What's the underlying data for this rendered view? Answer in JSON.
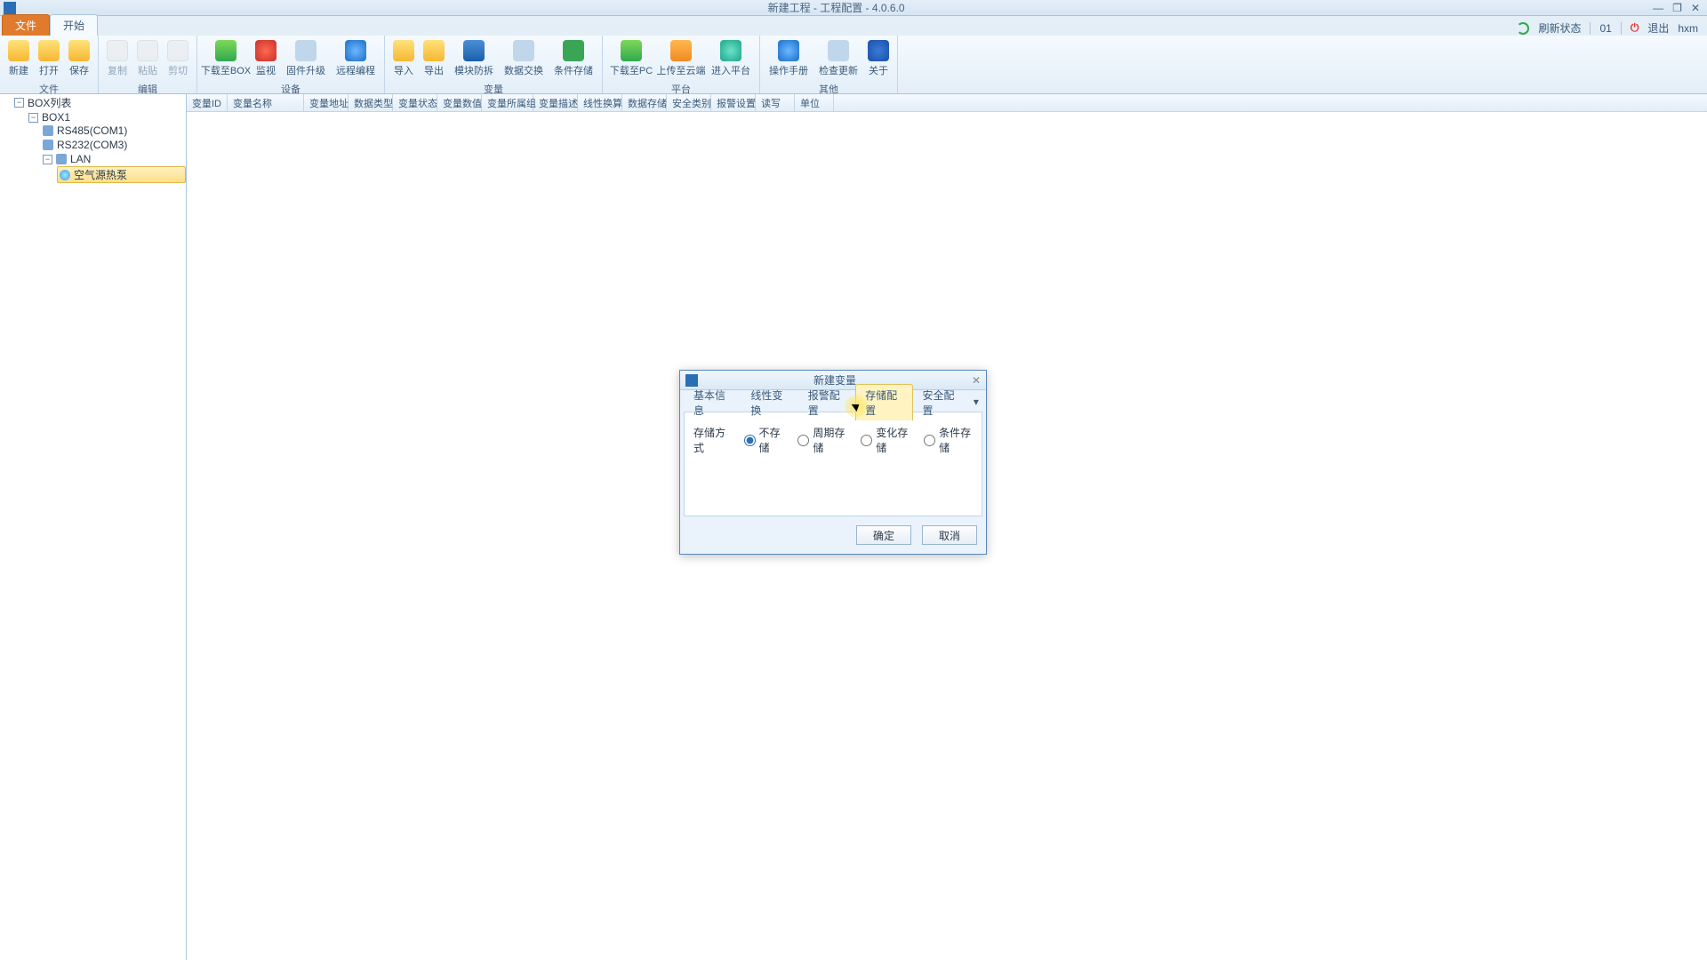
{
  "window": {
    "title": "新建工程 - 工程配置 - 4.0.6.0"
  },
  "win_buttons": {
    "min": "—",
    "max": "❐",
    "close": "✕"
  },
  "menu_tabs": {
    "file": "文件",
    "start": "开始"
  },
  "status": {
    "refresh": "刷新状态",
    "count": "01",
    "exit": "退出",
    "user": "hxm"
  },
  "ribbon": {
    "groups": {
      "file": {
        "label": "文件",
        "new": "新建",
        "open": "打开",
        "save": "保存"
      },
      "edit": {
        "label": "编辑",
        "copy": "复制",
        "paste": "粘贴",
        "cut": "剪切"
      },
      "device": {
        "label": "设备",
        "dlbox": "下载至BOX",
        "monitor": "监视",
        "fw": "固件升级",
        "remote": "远程编程"
      },
      "variable": {
        "label": "变量",
        "import": "导入",
        "export": "导出",
        "mod": "模块防拆",
        "dataex": "数据交换",
        "cond": "条件存储"
      },
      "platform": {
        "label": "平台",
        "dlpc": "下载至PC",
        "upcloud": "上传至云端",
        "enter": "进入平台"
      },
      "other": {
        "label": "其他",
        "help": "操作手册",
        "update": "检查更新",
        "about": "关于"
      }
    }
  },
  "tree": {
    "root": "BOX列表",
    "box": "BOX1",
    "rs485": "RS485(COM1)",
    "rs232": "RS232(COM3)",
    "lan": "LAN",
    "device": "空气源热泵"
  },
  "grid_cols": [
    "变量ID",
    "变量名称",
    "变量地址",
    "数据类型",
    "变量状态",
    "变量数值",
    "变量所属组",
    "变量描述",
    "线性换算",
    "数据存储",
    "安全类别",
    "报警设置",
    "读写",
    "单位"
  ],
  "dialog": {
    "title": "新建变量",
    "tabs": {
      "basic": "基本信息",
      "linear": "线性变换",
      "alarm": "报警配置",
      "storage": "存储配置",
      "security": "安全配置"
    },
    "storage": {
      "label": "存储方式",
      "opts": {
        "none": "不存储",
        "period": "周期存储",
        "change": "变化存储",
        "cond": "条件存储"
      }
    },
    "ok": "确定",
    "cancel": "取消"
  }
}
